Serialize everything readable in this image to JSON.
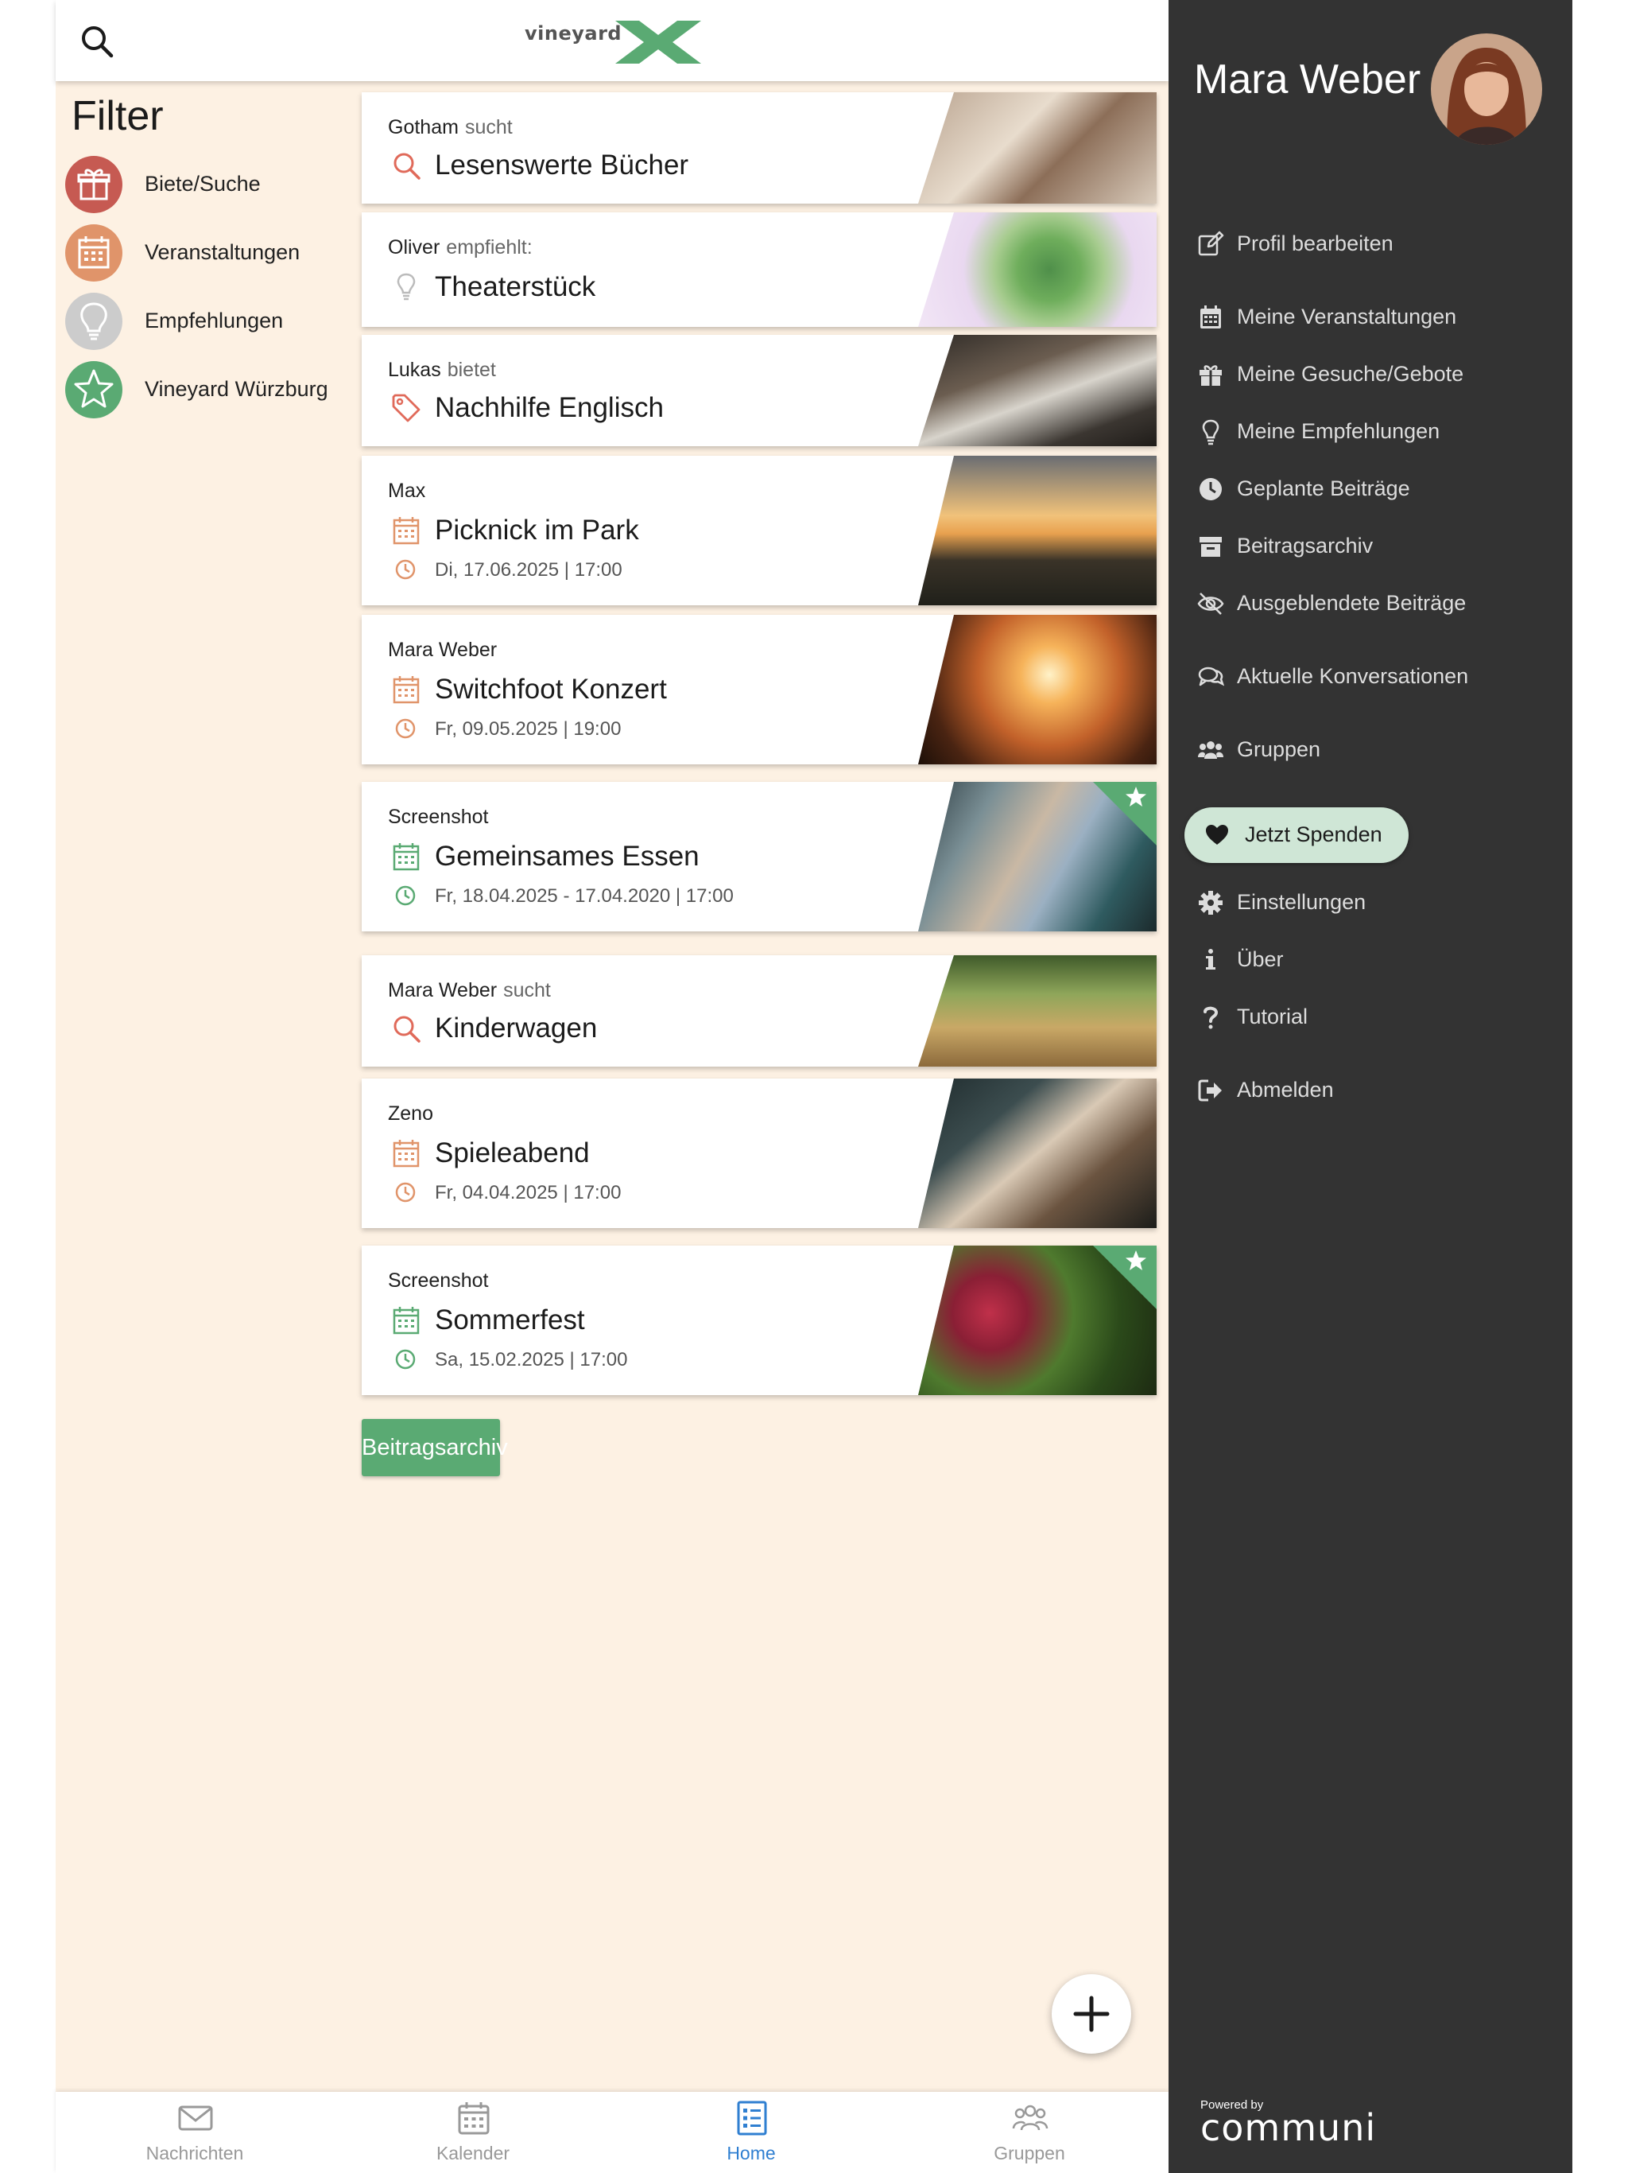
{
  "topbar": {
    "logo_text": "vineyard",
    "search_icon": "search-icon"
  },
  "filter": {
    "title": "Filter",
    "items": [
      {
        "label": "Biete/Suche",
        "icon": "gift-icon",
        "color": "#c65a52"
      },
      {
        "label": "Veranstaltungen",
        "icon": "calendar-icon",
        "color": "#e0946a"
      },
      {
        "label": "Empfehlungen",
        "icon": "lightbulb-icon",
        "color": "#cccccc"
      },
      {
        "label": "Vineyard Würzburg",
        "icon": "star-icon",
        "color": "#5aaa73"
      }
    ]
  },
  "posts": [
    {
      "author": "Gotham",
      "verb": "sucht",
      "title": "Lesenswerte Bücher",
      "type": "search"
    },
    {
      "author": "Oliver",
      "verb": "empfiehlt:",
      "title": "Theaterstück",
      "type": "recommend"
    },
    {
      "author": "Lukas",
      "verb": "bietet",
      "title": "Nachhilfe Englisch",
      "type": "offer"
    },
    {
      "author": "Max",
      "verb": "",
      "title": "Picknick im Park",
      "date": "Di, 17.06.2025 | 17:00",
      "type": "event"
    },
    {
      "author": "Mara Weber",
      "verb": "",
      "title": "Switchfoot Konzert",
      "date": "Fr, 09.05.2025 | 19:00",
      "type": "event"
    },
    {
      "author": "Screenshot",
      "verb": "",
      "title": "Gemeinsames Essen",
      "date": "Fr, 18.04.2025 - 17.04.2020 | 17:00",
      "type": "group-event"
    },
    {
      "author": "Mara Weber",
      "verb": "sucht",
      "title": "Kinderwagen",
      "type": "search"
    },
    {
      "author": "Zeno",
      "verb": "",
      "title": "Spieleabend",
      "date": "Fr, 04.04.2025 | 17:00",
      "type": "event"
    },
    {
      "author": "Screenshot",
      "verb": "",
      "title": "Sommerfest",
      "date": "Sa, 15.02.2025 | 17:00",
      "type": "group-event"
    }
  ],
  "archive_button": "Beitragsarchiv",
  "bottom_nav": [
    {
      "label": "Nachrichten",
      "icon": "envelope-icon"
    },
    {
      "label": "Kalender",
      "icon": "calendar-icon"
    },
    {
      "label": "Home",
      "icon": "list-icon",
      "active": true
    },
    {
      "label": "Gruppen",
      "icon": "people-icon"
    }
  ],
  "drawer": {
    "user_name": "Mara Weber",
    "menu": [
      {
        "label": "Profil bearbeiten",
        "icon": "edit-icon"
      },
      {
        "label": "Meine Veranstaltungen",
        "icon": "calendar-icon"
      },
      {
        "label": "Meine Gesuche/Gebote",
        "icon": "gift-icon"
      },
      {
        "label": "Meine Empfehlungen",
        "icon": "lightbulb-icon"
      },
      {
        "label": "Geplante Beiträge",
        "icon": "clock-icon"
      },
      {
        "label": "Beitragsarchiv",
        "icon": "archive-icon"
      },
      {
        "label": "Ausgeblendete Beiträge",
        "icon": "eye-slash-icon"
      },
      {
        "label": "Aktuelle Konversationen",
        "icon": "chat-icon"
      },
      {
        "label": "Gruppen",
        "icon": "users-icon"
      },
      {
        "label": "Einstellungen",
        "icon": "gear-icon"
      },
      {
        "label": "Über",
        "icon": "info-icon"
      },
      {
        "label": "Tutorial",
        "icon": "question-icon"
      },
      {
        "label": "Abmelden",
        "icon": "logout-icon"
      }
    ],
    "donate_label": "Jetzt Spenden",
    "powered_by": "Powered by",
    "brand": "communi"
  },
  "colors": {
    "accent_green": "#5aaa73",
    "warm_orange": "#e0946a",
    "search_red": "#e06a5a",
    "drawer_bg": "#333333",
    "main_bg": "#fdf1e3",
    "nav_active": "#2f7fd1"
  }
}
